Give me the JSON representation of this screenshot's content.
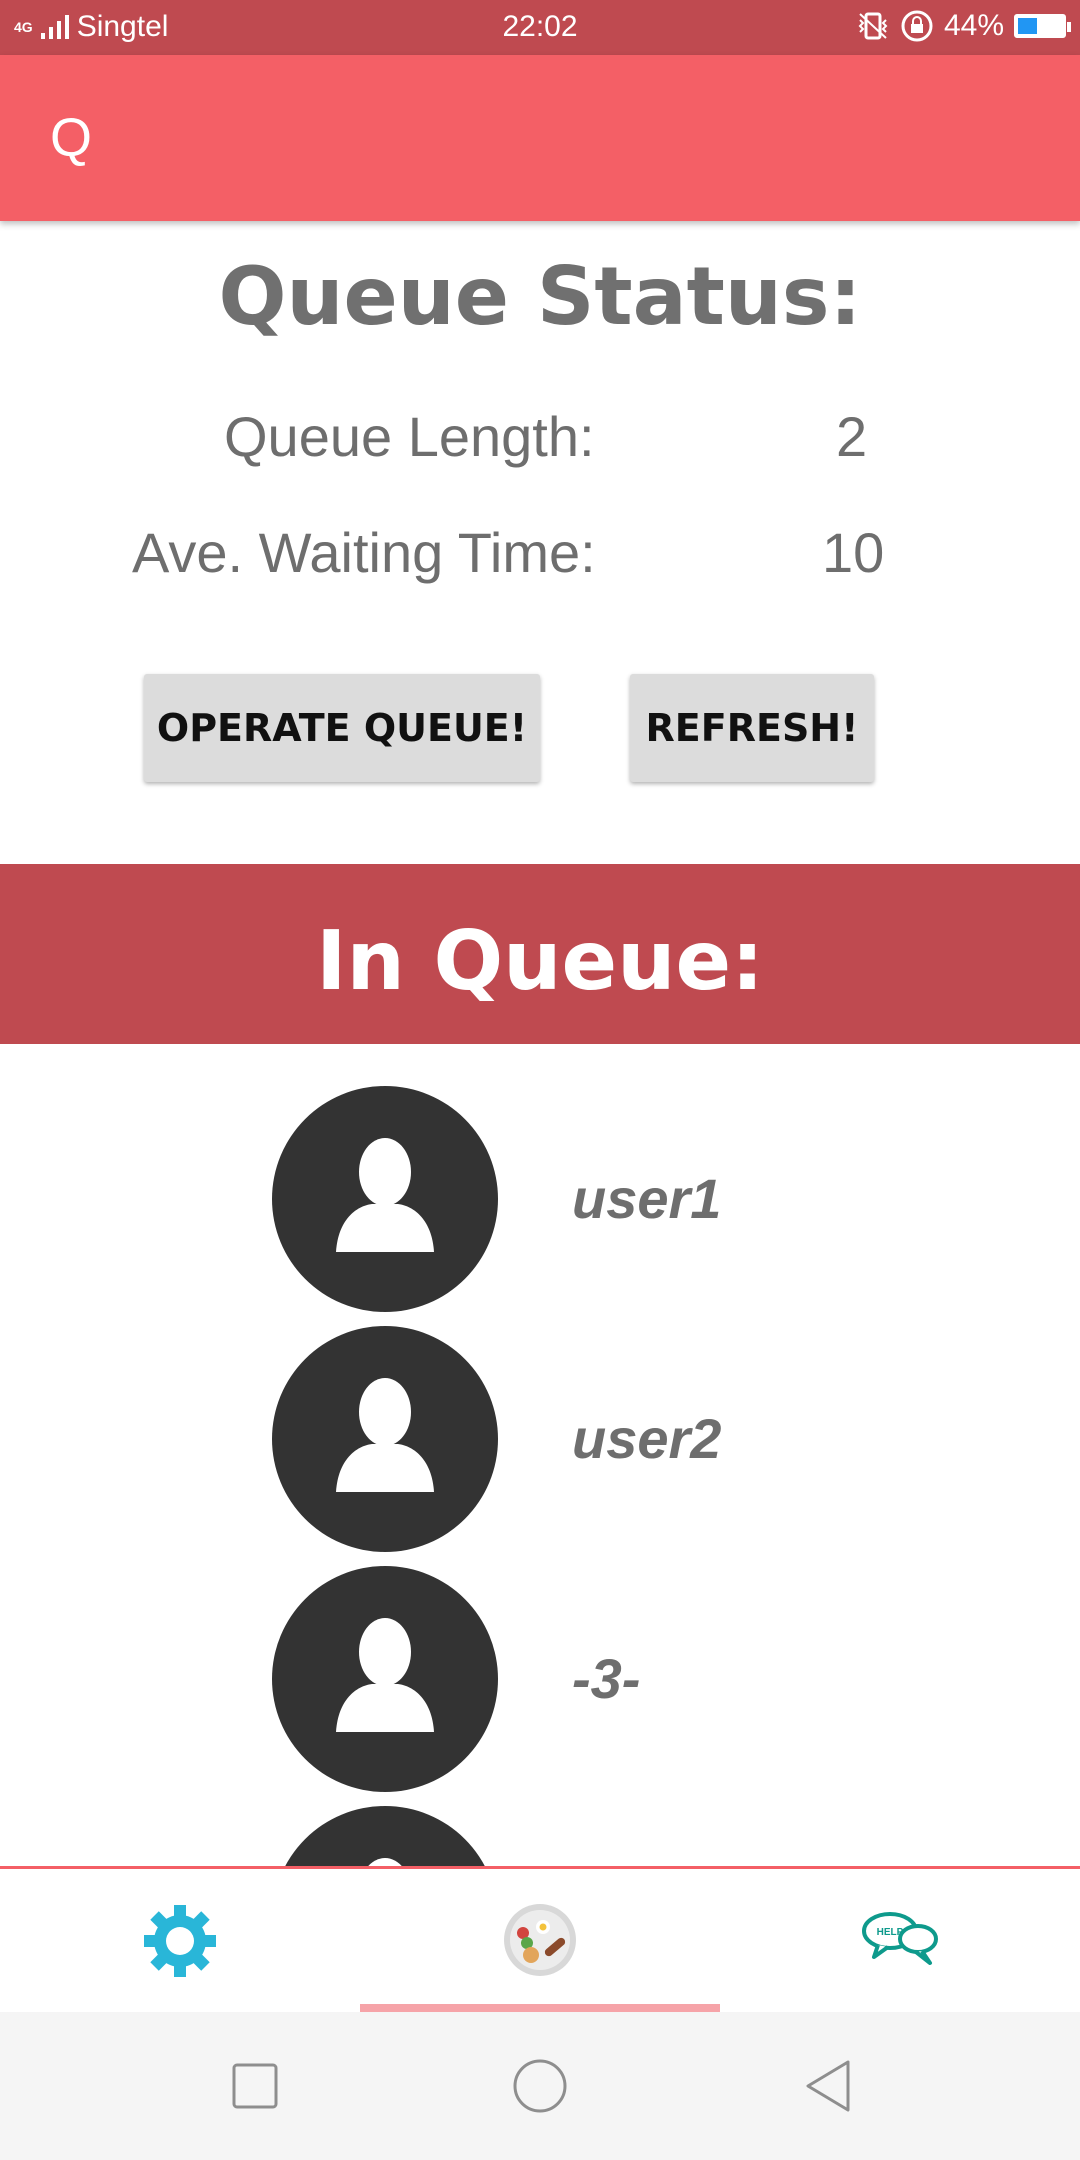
{
  "status_bar": {
    "network": "4G",
    "carrier": "Singtel",
    "time": "22:02",
    "battery_percent": "44%",
    "battery_level": 0.44
  },
  "app_bar": {
    "title": "Q"
  },
  "queue_status": {
    "title": "Queue Status:",
    "length_label": "Queue Length:",
    "length_value": "2",
    "wait_label": "Ave. Waiting Time:",
    "wait_value": "10"
  },
  "actions": {
    "operate_label": "OPERATE QUEUE!",
    "refresh_label": "REFRESH!"
  },
  "in_queue": {
    "title": "In Queue:",
    "users": [
      "user1",
      "user2",
      "-3-"
    ]
  },
  "bottom_nav": {
    "items": [
      "settings-icon",
      "food-icon",
      "help-icon"
    ],
    "selected": 1
  },
  "colors": {
    "status_bar": "#bf4a50",
    "app_bar": "#f45f66",
    "section_header": "#bf4a50",
    "settings_icon": "#29b6d8",
    "help_icon": "#0e9a8c"
  }
}
